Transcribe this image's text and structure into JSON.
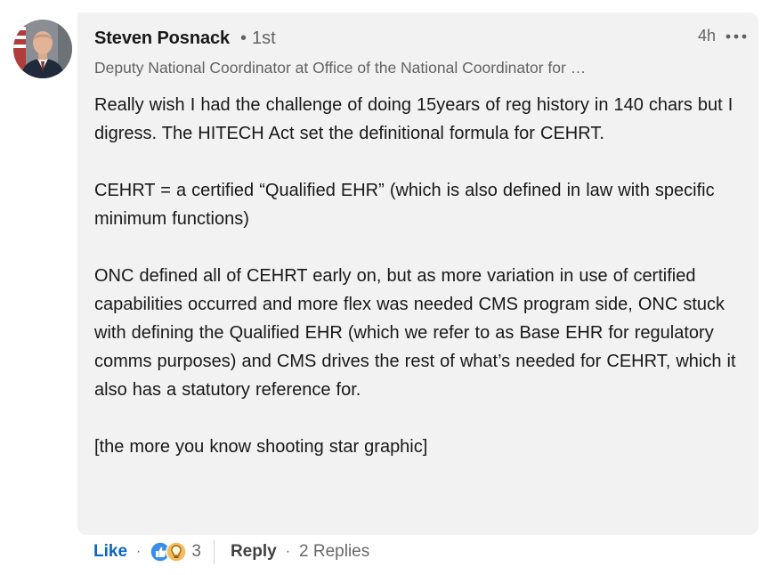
{
  "comment": {
    "author": {
      "name": "Steven Posnack",
      "degree_separator": "•",
      "degree": "1st",
      "headline": "Deputy National Coordinator at Office of the National Coordinator for …",
      "avatar_icon": "profile-photo"
    },
    "time": "4h",
    "more_icon": "ellipsis-icon",
    "paragraphs": [
      "Really wish I had the challenge of doing 15years of reg history in 140 chars but I digress. The HITECH Act set the definitional formula for CEHRT.",
      "CEHRT = a certified “Qualified EHR” (which is also defined in law with specific minimum functions)",
      "ONC defined all of CEHRT early on, but as more variation in use of certified capabilities occurred and more flex was needed CMS program side, ONC stuck with defining the Qualified EHR (which we refer to as Base EHR for regulatory comms purposes) and CMS drives the rest of what’s needed for CEHRT, which it also has a statutory reference for.",
      "[the more you know shooting star graphic]"
    ],
    "actions": {
      "like_label": "Like",
      "dot": "·",
      "reactions": [
        "like-reaction-icon",
        "insightful-reaction-icon"
      ],
      "reaction_count": "3",
      "reply_label": "Reply",
      "replies_label": "2 Replies"
    }
  },
  "colors": {
    "bubble_bg": "#f2f2f2",
    "link_blue": "#0a66c2",
    "muted_text": "#666666"
  }
}
